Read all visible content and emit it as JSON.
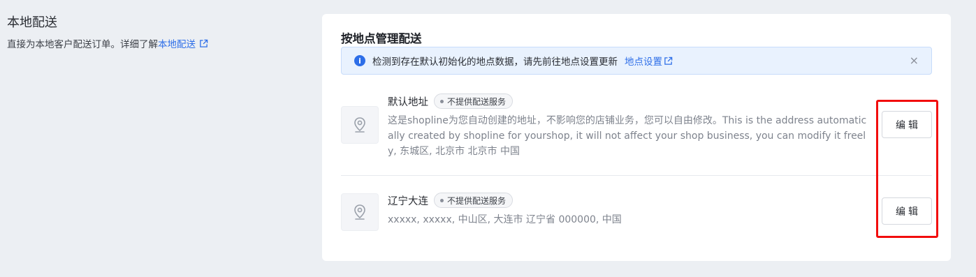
{
  "intro": {
    "title": "本地配送",
    "description": "直接为本地客户配送订单。详细了解",
    "learn_more_link": "本地配送",
    "link_icon": "external-link-icon"
  },
  "card": {
    "title": "按地点管理配送",
    "notice": {
      "icon": "info-icon",
      "text": "检测到存在默认初始化的地点数据，请先前往地点设置更新",
      "link_label": "地点设置",
      "close_label": "×"
    },
    "locations": [
      {
        "name": "默认地址",
        "badge": "不提供配送服务",
        "address": "这是shopline为您自动创建的地址，不影响您的店铺业务，您可以自由修改。This is the address automatically created by shopline for yourshop, it will not affect your shop business, you can modify it freely, 东城区, 北京市 北京市 中国",
        "edit_label": "编辑",
        "icon": "location-pin-icon"
      },
      {
        "name": "辽宁大连",
        "badge": "不提供配送服务",
        "address": "xxxxx, xxxxx, 中山区, 大连市 辽宁省 000000, 中国",
        "edit_label": "编辑",
        "icon": "location-pin-icon"
      }
    ]
  },
  "colors": {
    "accent": "#2d6ee8",
    "highlight": "#f20d0d",
    "background": "#eceff3"
  }
}
